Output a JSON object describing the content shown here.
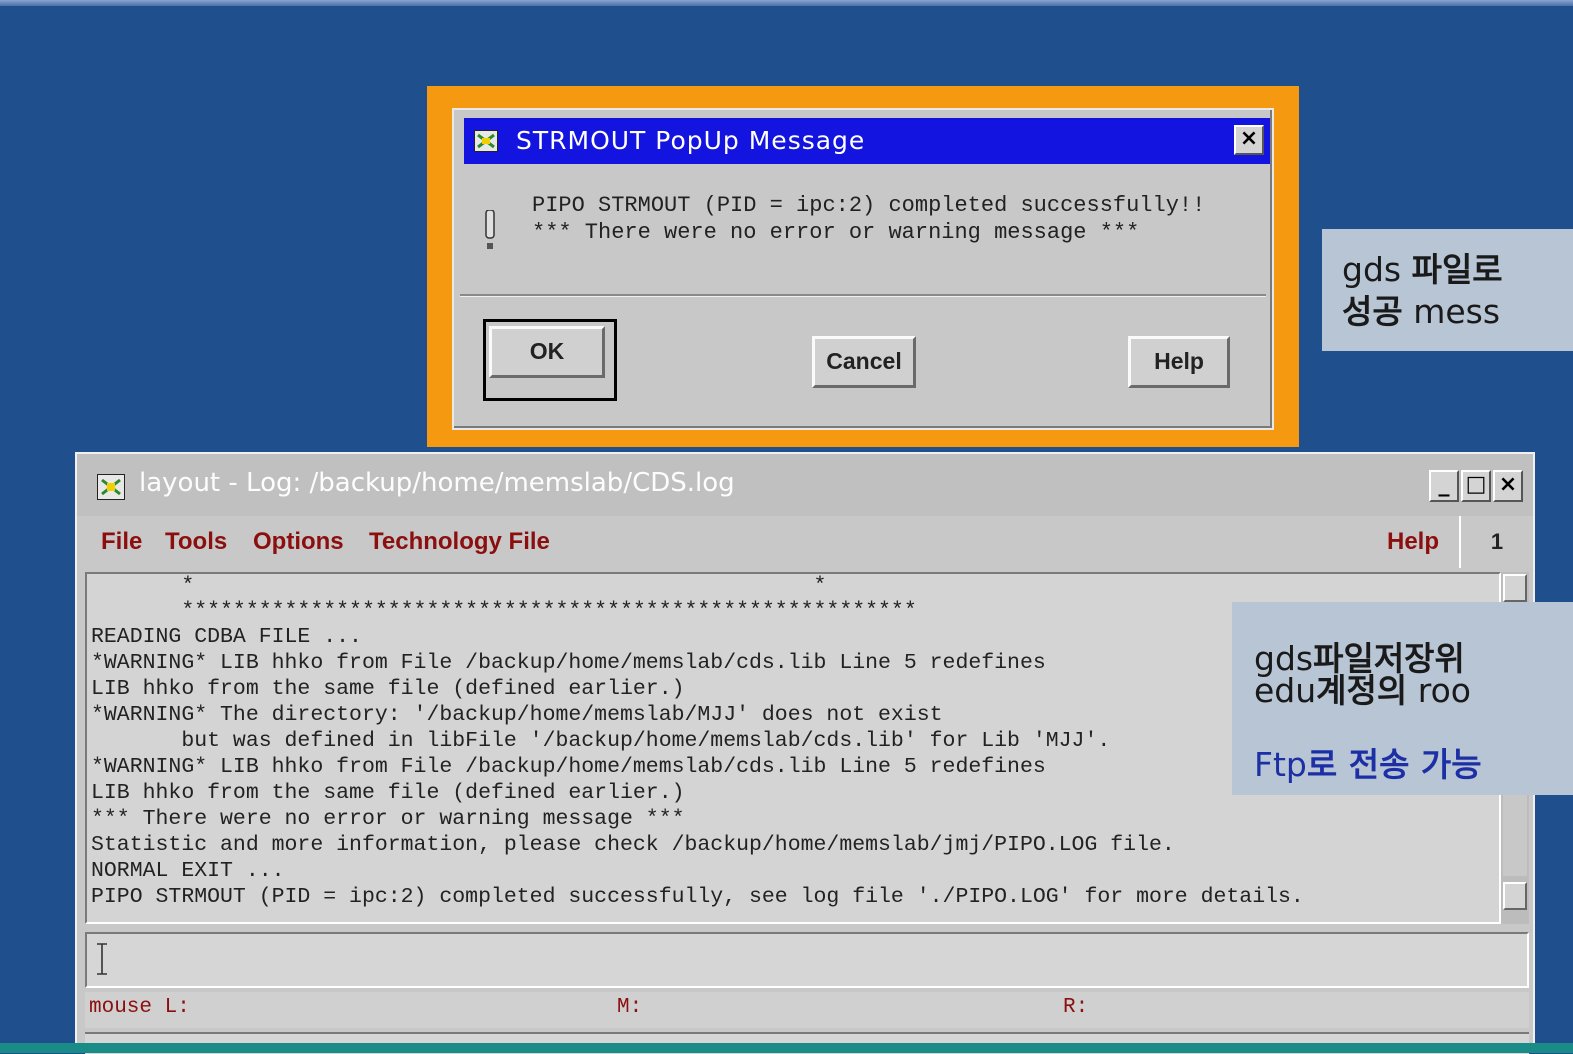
{
  "popup": {
    "title": "STRMOUT PopUp Message",
    "close_label": "×",
    "message_line1": "PIPO STRMOUT (PID = ipc:2) completed successfully!!",
    "message_line2": "*** There were no error or warning message ***",
    "ok_label": "OK",
    "cancel_label": "Cancel",
    "help_label": "Help"
  },
  "log_window": {
    "title": "layout - Log: /backup/home/memslab/CDS.log",
    "minimize_label": "_",
    "maximize_label": "□",
    "close_label": "×",
    "menu": {
      "file": "File",
      "tools": "Tools",
      "options": "Options",
      "technology_file": "Technology File",
      "help": "Help",
      "number": "1"
    },
    "lines": [
      "       *                                                *",
      "       *********************************************************",
      "READING CDBA FILE ...",
      "*WARNING* LIB hhko from File /backup/home/memslab/cds.lib Line 5 redefines",
      "LIB hhko from the same file (defined earlier.)",
      "*WARNING* The directory: '/backup/home/memslab/MJJ' does not exist",
      "       but was defined in libFile '/backup/home/memslab/cds.lib' for Lib 'MJJ'.",
      "*WARNING* LIB hhko from File /backup/home/memslab/cds.lib Line 5 redefines",
      "LIB hhko from the same file (defined earlier.)",
      "*** There were no error or warning message ***",
      "Statistic and more information, please check /backup/home/memslab/jmj/PIPO.LOG file.",
      "NORMAL EXIT ...",
      "PIPO STRMOUT (PID = ipc:2) completed successfully, see log file './PIPO.LOG' for more details."
    ],
    "mouse_l": "mouse L:",
    "mouse_m": "M:",
    "mouse_r": "R:"
  },
  "annotations": {
    "note1_line1_a": "gds ",
    "note1_line1_b": "파일로",
    "note1_line2_a": "성공",
    "note1_line2_b": " mess",
    "note2_line1_a": "gds",
    "note2_line1_b": "파일저장위",
    "note2_line2_a": "edu",
    "note2_line2_b": "계정의",
    "note2_line2_c": " roo",
    "note2_line3_a": "Ftp",
    "note2_line3_b": "로 전송 가능"
  },
  "colors": {
    "background": "#1f4f8c",
    "popup_frame": "#f59a10",
    "popup_title_bar": "#1414e0",
    "menu_text": "#8b0f0f"
  },
  "icons": [
    "window-icon",
    "close-icon",
    "exclamation-icon",
    "minimize-icon",
    "maximize-icon",
    "text-cursor-icon"
  ]
}
